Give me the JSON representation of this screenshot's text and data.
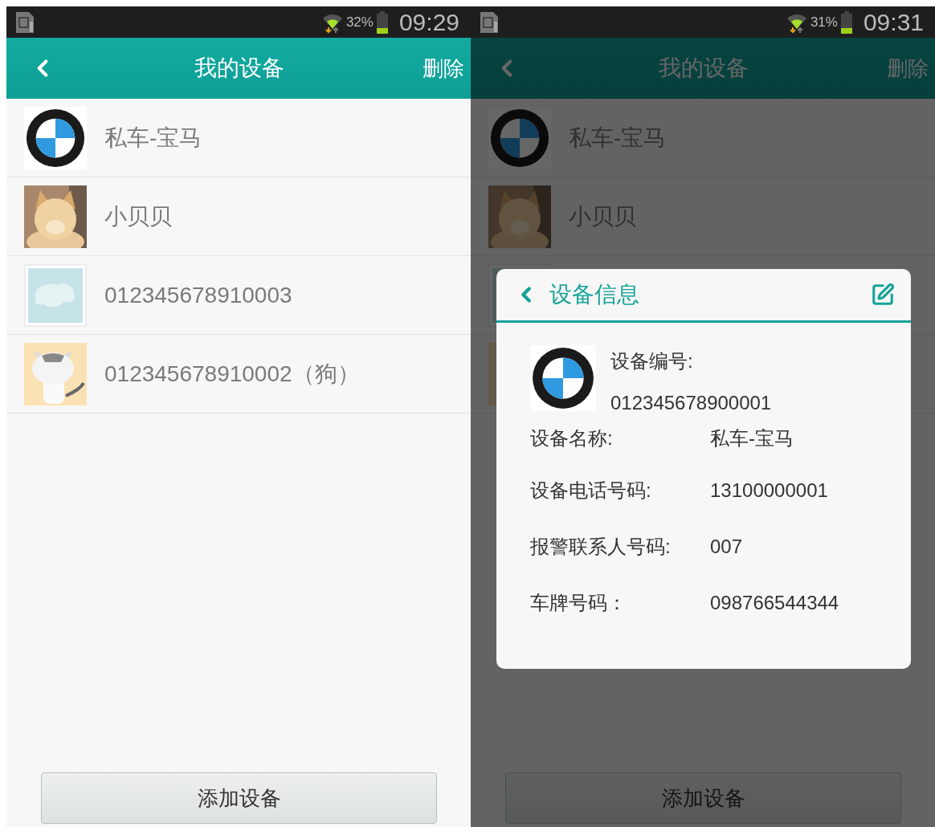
{
  "screens": [
    {
      "status_bar": {
        "battery": "32%",
        "time": "09:29"
      },
      "header": {
        "title": "我的设备",
        "action": "删除"
      },
      "dimmed": false,
      "devices": [
        {
          "kind": "logo",
          "name": "私车-宝马"
        },
        {
          "name": "小贝贝"
        },
        {
          "kind": "placeholder",
          "name": "012345678910003"
        },
        {
          "kind": "cartoon",
          "name": "012345678910002（狗）"
        }
      ],
      "add_button": "添加设备"
    },
    {
      "status_bar": {
        "battery": "31%",
        "time": "09:31"
      },
      "header": {
        "title": "我的设备",
        "action": "删除"
      },
      "dimmed": true,
      "devices": [
        {
          "kind": "logo",
          "name": "私车-宝马"
        },
        {
          "name": "小贝贝"
        },
        {
          "kind": "placeholder"
        },
        {
          "kind": "cartoon"
        }
      ],
      "add_button": "添加设备",
      "dialog": {
        "title": "设备信息",
        "id_label": "设备编号:",
        "id_value": "012345678900001",
        "avatar": {
          "kind": "logo"
        },
        "fields": [
          {
            "label": "设备名称:",
            "value": "私车-宝马"
          },
          {
            "label": "设备电话号码:",
            "value": "13100000001"
          },
          {
            "label": "报警联系人号码:",
            "value": "007"
          },
          {
            "label": "车牌号码：",
            "value": "098766544344"
          }
        ]
      }
    }
  ]
}
